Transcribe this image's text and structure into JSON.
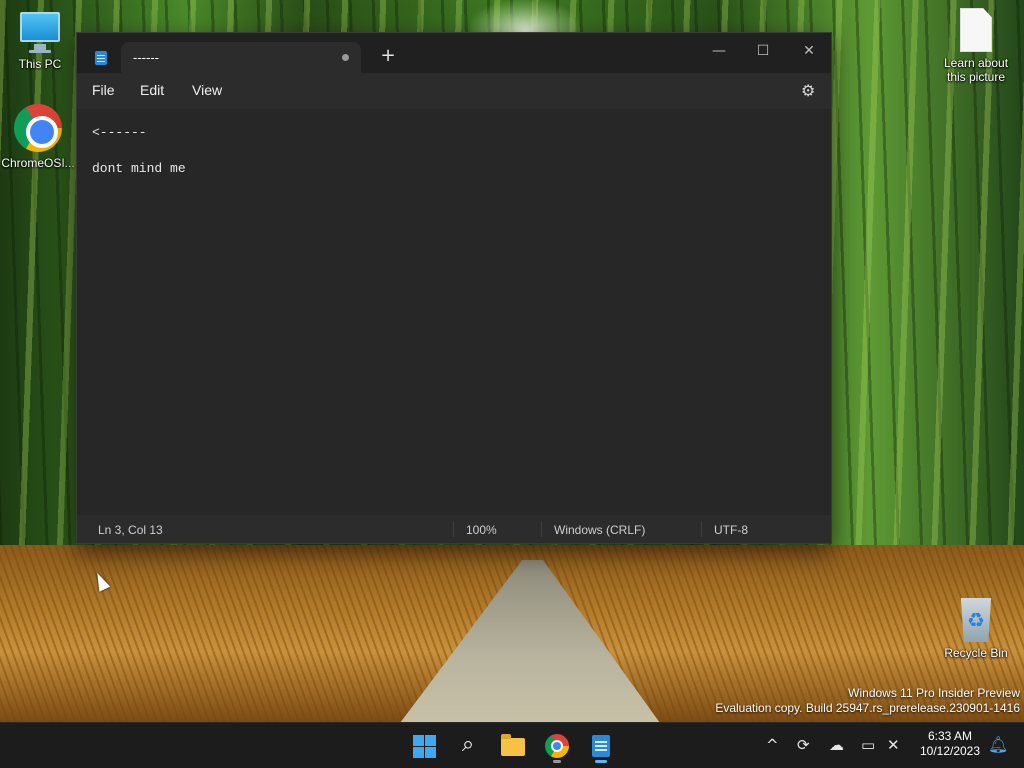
{
  "desktop": {
    "icons": [
      {
        "label": "This PC"
      },
      {
        "label": "ChromeOSI..."
      },
      {
        "label": "Learn about this picture"
      },
      {
        "label": "Recycle Bin"
      }
    ]
  },
  "notepad": {
    "tab_title": "------",
    "menu": {
      "file": "File",
      "edit": "Edit",
      "view": "View"
    },
    "lines": [
      "<------",
      "",
      "dont mind me"
    ],
    "status": {
      "position": "Ln 3, Col 13",
      "zoom": "100%",
      "line_endings": "Windows (CRLF)",
      "encoding": "UTF-8"
    },
    "colors": {
      "background": "#272727",
      "accent": "#2a8ad8"
    }
  },
  "watermark": {
    "line1": "Windows 11 Pro Insider Preview",
    "line2": "Evaluation copy. Build 25947.rs_prerelease.230901-1416"
  },
  "taskbar": {
    "apps": [
      "start-icon",
      "search-icon",
      "file-explorer-icon",
      "chrome-icon",
      "notepad-icon"
    ],
    "clock": {
      "time": "6:33 AM",
      "date": "10/12/2023"
    }
  }
}
